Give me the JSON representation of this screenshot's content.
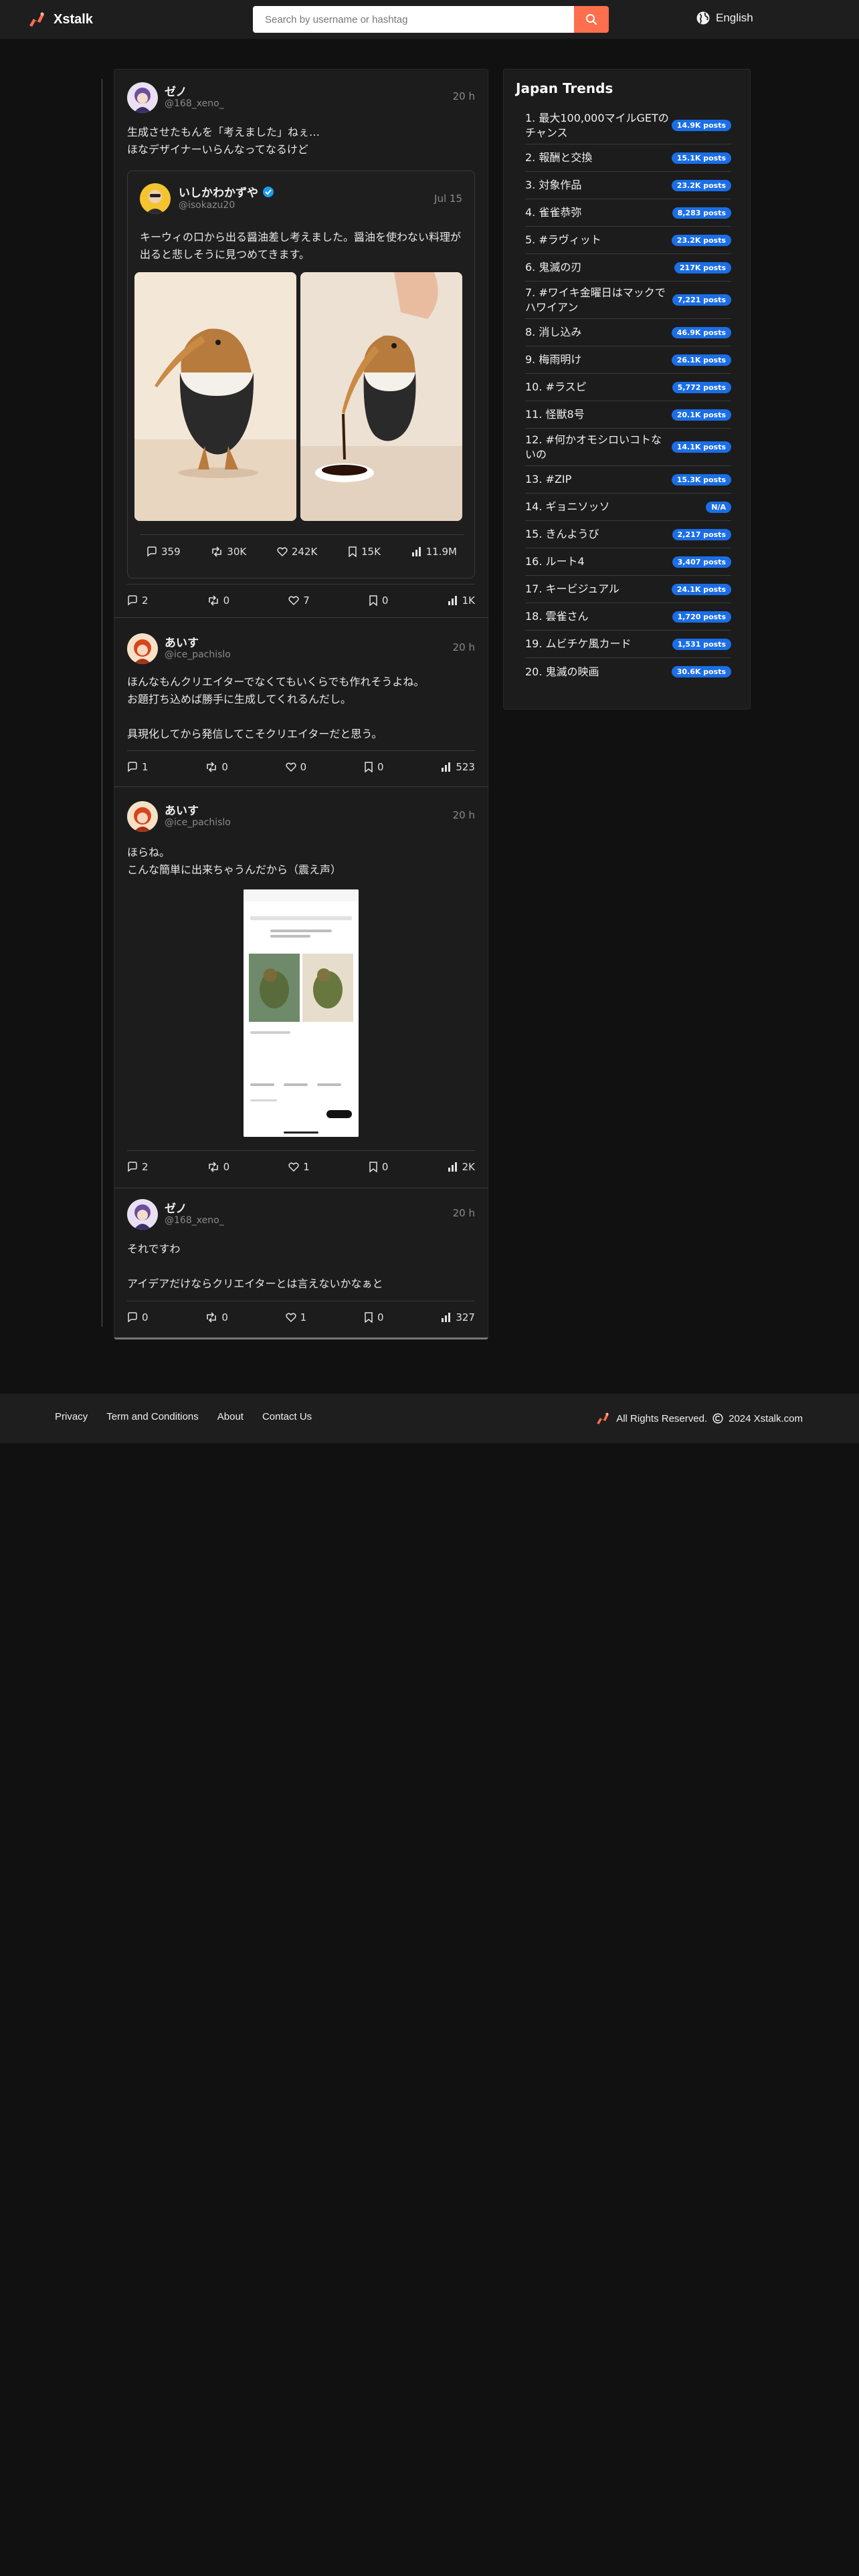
{
  "header": {
    "brand": "Xstalk",
    "search_placeholder": "Search by username or hashtag",
    "language": "English"
  },
  "thread": [
    {
      "name": "ゼノ",
      "handle": "@168_xeno_",
      "time": "20 h",
      "text": "生成させたもんを「考えました」ねぇ…\nほなデザイナーいらんなってなるけど",
      "quote": {
        "name": "いしかわかずや",
        "handle": "@isokazu20",
        "time": "Jul 15",
        "text": "キーウィの口から出る醤油差し考えました。醤油を使わない料理が出ると悲しそうに見つめてきます。",
        "stats": {
          "replies": "359",
          "reposts": "30K",
          "likes": "242K",
          "bookmarks": "15K",
          "views": "11.9M"
        }
      },
      "stats": {
        "replies": "2",
        "reposts": "0",
        "likes": "7",
        "bookmarks": "0",
        "views": "1K"
      }
    },
    {
      "name": "あいす",
      "handle": "@ice_pachislo",
      "time": "20 h",
      "text": "ほんなもんクリエイターでなくてもいくらでも作れそうよね。\nお題打ち込めば勝手に生成してくれるんだし。\n\n具現化してから発信してこそクリエイターだと思う。",
      "stats": {
        "replies": "1",
        "reposts": "0",
        "likes": "0",
        "bookmarks": "0",
        "views": "523"
      }
    },
    {
      "name": "あいす",
      "handle": "@ice_pachislo",
      "time": "20 h",
      "text": "ほらね。\nこんな簡単に出来ちゃうんだから（震え声）",
      "stats": {
        "replies": "2",
        "reposts": "0",
        "likes": "1",
        "bookmarks": "0",
        "views": "2K"
      }
    },
    {
      "name": "ゼノ",
      "handle": "@168_xeno_",
      "time": "20 h",
      "text": "それですわ\n\nアイデアだけならクリエイターとは言えないかなぁと",
      "stats": {
        "replies": "0",
        "reposts": "0",
        "likes": "1",
        "bookmarks": "0",
        "views": "327"
      }
    }
  ],
  "trends": {
    "title": "Japan Trends",
    "items": [
      {
        "label": "1. 最大100,000マイルGETのチャンス",
        "posts": "14.9K posts"
      },
      {
        "label": "2. 報酬と交換",
        "posts": "15.1K posts"
      },
      {
        "label": "3. 対象作品",
        "posts": "23.2K posts"
      },
      {
        "label": "4. 雀雀恭弥",
        "posts": "8,283 posts"
      },
      {
        "label": "5. #ラヴィット",
        "posts": "23.2K posts"
      },
      {
        "label": "6. 鬼滅の刃",
        "posts": "217K posts"
      },
      {
        "label": "7. #ワイキ金曜日はマックでハワイアン",
        "posts": "7,221 posts"
      },
      {
        "label": "8. 消し込み",
        "posts": "46.9K posts"
      },
      {
        "label": "9. 梅雨明け",
        "posts": "26.1K posts"
      },
      {
        "label": "10. #ラスピ",
        "posts": "5,772 posts"
      },
      {
        "label": "11. 怪獣8号",
        "posts": "20.1K posts"
      },
      {
        "label": "12. #何かオモシロいコトないの",
        "posts": "14.1K posts"
      },
      {
        "label": "13. #ZIP",
        "posts": "15.3K posts"
      },
      {
        "label": "14. ギョニソッソ",
        "posts": "N/A"
      },
      {
        "label": "15. きんようび",
        "posts": "2,217 posts"
      },
      {
        "label": "16. ルート4",
        "posts": "3,407 posts"
      },
      {
        "label": "17. キービジュアル",
        "posts": "24.1K posts"
      },
      {
        "label": "18. 雲雀さん",
        "posts": "1,720 posts"
      },
      {
        "label": "19. ムビチケ風カード",
        "posts": "1,531 posts"
      },
      {
        "label": "20. 鬼滅の映画",
        "posts": "30.6K posts"
      }
    ]
  },
  "footer": {
    "links": [
      "Privacy",
      "Term and Conditions",
      "About",
      "Contact Us"
    ],
    "copyright": "All Rights Reserved.",
    "copyright_year": "2024 Xstalk.com"
  }
}
